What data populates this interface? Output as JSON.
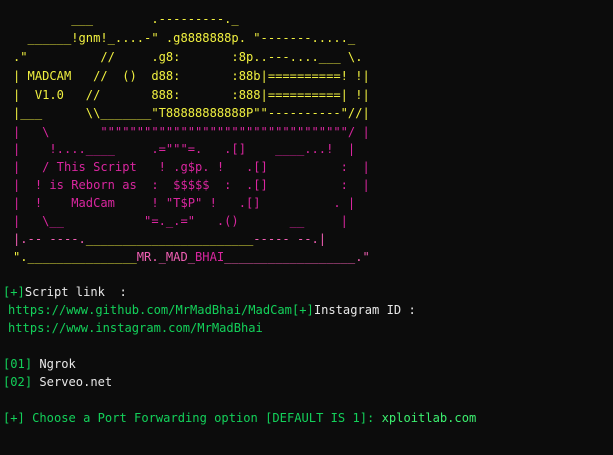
{
  "colors": {
    "background": "#0c0c0c",
    "white": "#e8e8e8",
    "cyan": "#3fc8f4",
    "green": "#13d15a",
    "yellow": "#f1f140",
    "magenta": "#d9269f",
    "pink": "#f25fb4",
    "bright_green": "#3cf06f"
  },
  "banner": [
    [
      {
        "t": "        ___        .---------._",
        "c": "yellow"
      }
    ],
    [
      {
        "t": "  ______!gnm!_....-\" .g8888888p. \"-------....._",
        "c": "yellow"
      }
    ],
    [
      {
        "t": ".\"          //     .g8:       :8p..---....___ \\.",
        "c": "yellow"
      }
    ],
    [
      {
        "t": "| MADCAM   //  ()  d88:       :88b|==========! !|",
        "c": "yellow"
      }
    ],
    [
      {
        "t": "|  V1.0   //       888:       :888|==========| !|",
        "c": "yellow"
      }
    ],
    [
      {
        "t": "|___      \\\\_______\"T88888888888P\"\"----------\"//|",
        "c": "yellow"
      }
    ],
    [
      {
        "t": "|   \\       \"\"\"\"\"\"\"\"\"\"\"\"\"\"\"\"\"\"\"\"\"\"\"\"\"\"\"\"\"\"\"\"\"\"/ |",
        "c": "magenta"
      }
    ],
    [
      {
        "t": "|    !....____     .=\"\"\"=.   .[]    ____...!  |",
        "c": "magenta"
      }
    ],
    [
      {
        "t": "|   / This Script   ! .g$p. !   .[]          :  |",
        "c": "magenta"
      }
    ],
    [
      {
        "t": "|  ! is Reborn as  :  $$$$$  :  .[]          :  |",
        "c": "magenta"
      }
    ],
    [
      {
        "t": "|  !    MadCam     ! \"T$P\" !   .[]          . |",
        "c": "magenta"
      }
    ],
    [
      {
        "t": "|   \\__           \"=._.=\"   .()       __     |",
        "c": "magenta"
      }
    ],
    [
      {
        "t": "|.-- ----.",
        "c": "pink"
      },
      {
        "t": "_______________________",
        "c": "yellow"
      },
      {
        "t": "----- --.|",
        "c": "pink"
      }
    ],
    [
      {
        "t": "\"._______________",
        "c": "yellow"
      },
      {
        "t": "MR._MAD_",
        "c": "pink"
      },
      {
        "t": "BHAI",
        "c": "magenta"
      },
      {
        "t": "__________________.\"",
        "c": "pink"
      }
    ]
  ],
  "lines": {
    "script_link_bracket": "[+]",
    "script_link_label": "Script link  :",
    "github_url": "https://www.github.com/MrMadBhai/MadCam",
    "instagram_bracket": "[+]",
    "instagram_label": "Instagram ID :",
    "instagram_url": "https://www.instagram.com/MrMadBhai",
    "opt1_num": "[01]",
    "opt1_label": " Ngrok",
    "opt2_num": "[02]",
    "opt2_label": " Serveo.net",
    "prompt_text": "[+] Choose a Port Forwarding option [DEFAULT IS 1]:",
    "prompt_input": " xploitlab.com"
  }
}
